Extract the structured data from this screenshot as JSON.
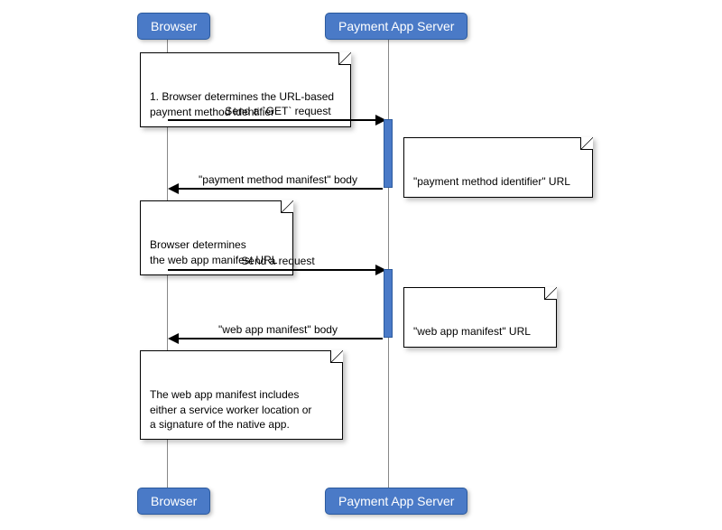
{
  "diagram": {
    "participants": {
      "browser": "Browser",
      "server": "Payment App Server"
    },
    "notes": {
      "n1": "1. Browser determines the URL-based\npayment method identifier",
      "n2": "\"payment method identifier\" URL",
      "n3": "Browser determines\nthe web app manifest URL",
      "n4": "\"web app manifest\" URL",
      "n5": "The web app manifest includes\neither a service worker location or\na signature of the native app."
    },
    "messages": {
      "m1": "Send a `GET` request",
      "m2": "\"payment method manifest\" body",
      "m3": "Send a request",
      "m4": "\"web app manifest\" body"
    }
  }
}
